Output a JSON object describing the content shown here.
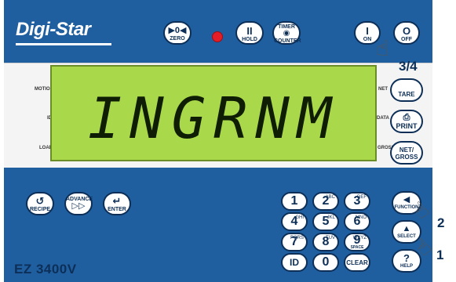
{
  "brand": {
    "logo": "Digi-Star",
    "model": "EZ 3400V"
  },
  "top_buttons": {
    "zero": {
      "symbol": "▶0◀",
      "label": "ZERO"
    },
    "hold": {
      "symbol": "II",
      "label": "HOLD"
    },
    "timer": {
      "top_label": "TIMER",
      "symbol": "◉",
      "label": "COUNTER"
    },
    "on": {
      "symbol": "I",
      "label": "ON"
    },
    "off": {
      "symbol": "O",
      "label": "OFF"
    }
  },
  "display": {
    "text": "INGRNM",
    "labels": {
      "motion": "MOTION",
      "id": "ID",
      "load": "LOAD",
      "net": "NET",
      "data": "DATA",
      "gross": "GROSS"
    }
  },
  "right_buttons": {
    "tare": {
      "label": "TARE"
    },
    "print": {
      "label": "PRINT"
    },
    "netgross": {
      "label_top": "NET/",
      "label_bottom": "GROSS"
    }
  },
  "bottom_left_buttons": {
    "recipe": {
      "symbol": "↺",
      "label": "RECIPE"
    },
    "advance": {
      "label": "ADVANCE",
      "symbol": "▷▷"
    },
    "enter": {
      "symbol": "↵",
      "label": "ENTER"
    }
  },
  "keypad": [
    {
      "key": "1",
      "sub": ""
    },
    {
      "key": "2",
      "sub": "ABC"
    },
    {
      "key": "3",
      "sub": "DEF"
    },
    {
      "key": "4",
      "sub": "GHI"
    },
    {
      "key": "5",
      "sub": "JKL"
    },
    {
      "key": "6",
      "sub": "MNO"
    },
    {
      "key": "7",
      "sub": "PQRS"
    },
    {
      "key": "8",
      "sub": "TUV"
    },
    {
      "key": "9",
      "sub": "WXYZ",
      "label": "SPACE"
    },
    {
      "key": "ID",
      "sub": ""
    },
    {
      "key": "0",
      "sub": ""
    },
    {
      "key": "CLEAR",
      "sub": ""
    }
  ],
  "function_buttons": {
    "function": {
      "symbol": "◀",
      "label": "FUNCTION"
    },
    "select": {
      "symbol": "▲",
      "label": "SELECT"
    },
    "help": {
      "symbol": "?",
      "label": "HELP"
    }
  },
  "steps": {
    "step1": "1",
    "step2": "2",
    "step34": "3/4"
  }
}
